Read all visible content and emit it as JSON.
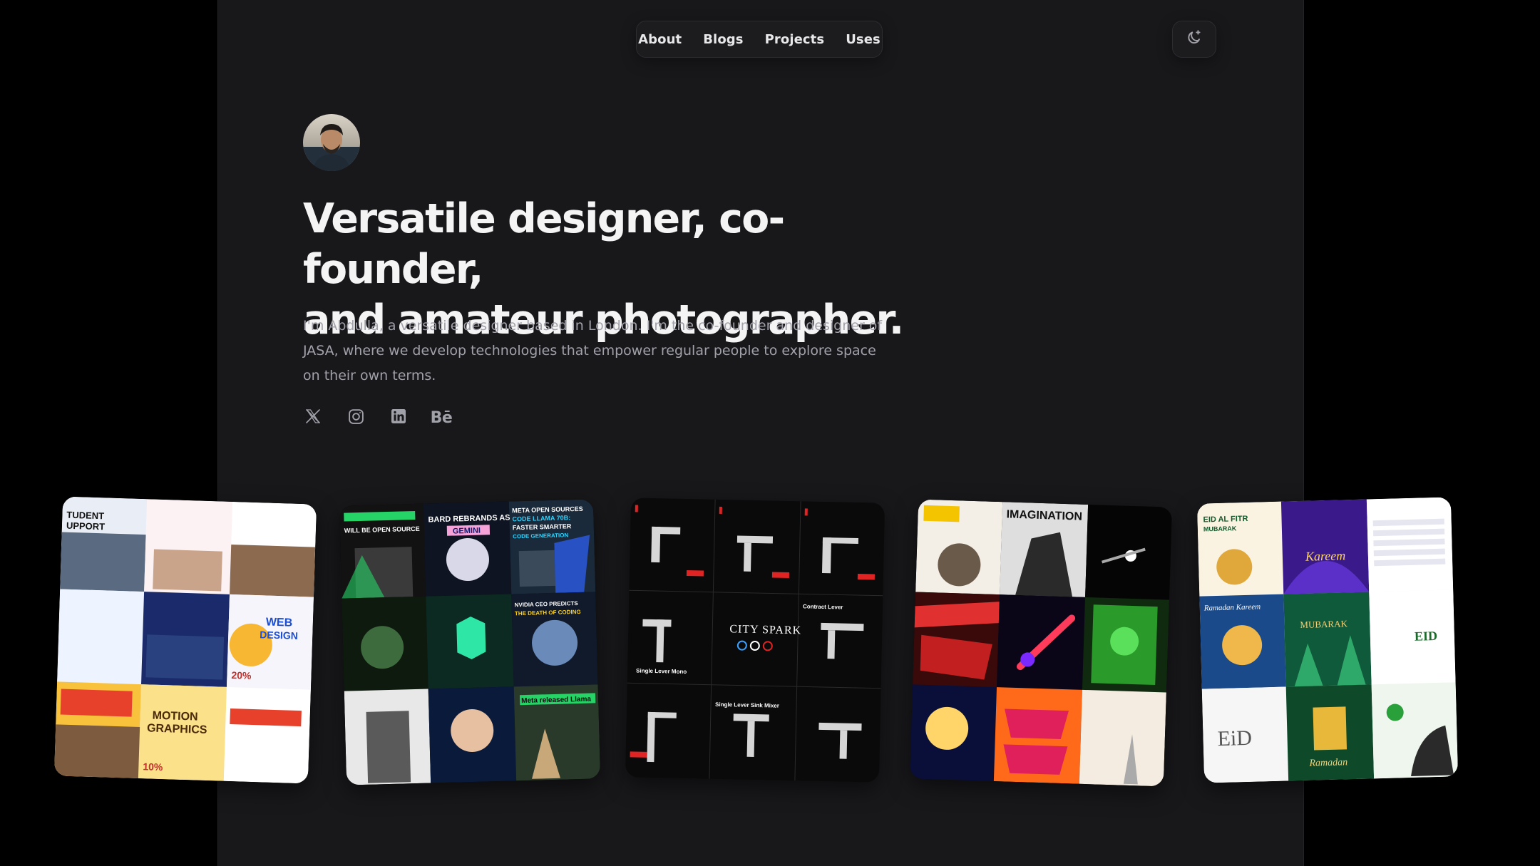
{
  "nav": {
    "items": [
      {
        "label": "About"
      },
      {
        "label": "Blogs"
      },
      {
        "label": "Projects"
      },
      {
        "label": "Uses"
      }
    ]
  },
  "theme_toggle": {
    "icon": "moon-sparkle-icon"
  },
  "hero": {
    "headline_line1": "Versatile designer, co-founder,",
    "headline_line2": "and amateur photographer.",
    "intro": "I'm Abdulla, a versatile designer based in London. I'm the co-founder and designer of JASA, where we develop technologies that empower regular people to explore space on their own terms."
  },
  "socials": [
    {
      "icon": "x-twitter-icon"
    },
    {
      "icon": "instagram-icon"
    },
    {
      "icon": "linkedin-icon"
    },
    {
      "icon": "behance-icon",
      "label": "Bē"
    }
  ],
  "gallery": {
    "card1": {
      "texts": [
        "TUDENT",
        "UPPORT",
        "WEB",
        "DESIGN",
        "MOTION",
        "GRAPHICS",
        "20%",
        "10%"
      ]
    },
    "card2": {
      "texts": [
        "WILL BE OPEN SOURCE",
        "BARD REBRANDS AS",
        "GEMINI",
        "META OPEN SOURCES",
        "CODE LLAMA 70B:",
        "FASTER SMARTER",
        "CODE GENERATION",
        "NVIDIA CEO PREDICTS",
        "THE DEATH OF CODING",
        "Meta released Llama"
      ]
    },
    "card3": {
      "texts": [
        "CITY SPARK",
        "Single Lever Mono",
        "Contract Lever",
        "Single Lever Sink Mixer"
      ]
    },
    "card4": {
      "texts": [
        "IMAGINATION"
      ]
    },
    "card5": {
      "texts": [
        "EID AL FITR",
        "MUBARAK",
        "Kareem",
        "Ramadan Kareem",
        "EID",
        "MUBARAK",
        "EiD",
        "Ramadan"
      ]
    }
  },
  "colors": {
    "page_bg": "#000000",
    "column_bg": "#18181b",
    "headline": "#f4f4f5",
    "body_text": "#a1a1aa"
  }
}
